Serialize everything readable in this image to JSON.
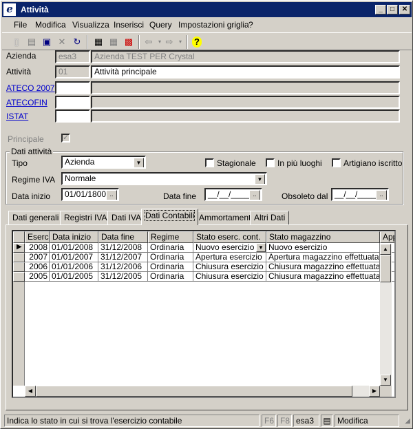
{
  "window": {
    "title": "Attività"
  },
  "menu": [
    "File",
    "Modifica",
    "Visualizza",
    "Inserisci",
    "Query",
    "Impostazioni griglia",
    "?"
  ],
  "form": {
    "azienda": {
      "label": "Azienda",
      "code": "esa3",
      "name": "Azienda TEST PER Crystal"
    },
    "attivita": {
      "label": "Attività",
      "code": "01",
      "name": "Attività principale"
    },
    "ateco": {
      "label": "ATECO 2007",
      "code": "",
      "name": ""
    },
    "atecofin": {
      "label": "ATECOFIN",
      "code": "",
      "name": ""
    },
    "istat": {
      "label": "ISTAT",
      "code": "",
      "name": ""
    },
    "principale": {
      "label": "Principale",
      "checked": true
    }
  },
  "dati_attivita": {
    "legend": "Dati attività",
    "tipo_label": "Tipo",
    "tipo_value": "Azienda",
    "stagionale": "Stagionale",
    "piu_luoghi": "In più luoghi",
    "artigiano": "Artigiano iscritto",
    "regime_label": "Regime IVA",
    "regime_value": "Normale",
    "data_inizio_label": "Data inizio",
    "data_inizio": "01/01/1800",
    "data_fine_label": "Data fine",
    "data_fine": "__/__/____",
    "obsoleto_label": "Obsoleto dal",
    "obsoleto": "__/__/____",
    "dots": ".."
  },
  "tabs": [
    "Dati generali",
    "Registri IVA",
    "Dati IVA",
    "Dati Contabili",
    "Ammortamenti",
    "Altri Dati"
  ],
  "grid": {
    "columns": [
      "Eserc.",
      "Data inizio",
      "Data fine",
      "Regime",
      "Stato eserc. cont.",
      "Stato magazzino",
      "App"
    ],
    "rows": [
      [
        "2008",
        "01/01/2008",
        "31/12/2008",
        "Ordinaria",
        "Nuovo esercizio",
        "Nuovo esercizio"
      ],
      [
        "2007",
        "01/01/2007",
        "31/12/2007",
        "Ordinaria",
        "Apertura esercizio",
        "Apertura magazzino effettuata"
      ],
      [
        "2006",
        "01/01/2006",
        "31/12/2006",
        "Ordinaria",
        "Chiusura esercizio",
        "Chiusura magazzino effettuata"
      ],
      [
        "2005",
        "01/01/2005",
        "31/12/2005",
        "Ordinaria",
        "Chiusura esercizio",
        "Chiusura magazzino effettuata"
      ]
    ]
  },
  "statusbar": {
    "message": "Indica lo stato in cui si trova l'esercizio contabile",
    "f6": "F6",
    "f8": "F8",
    "company": "esa3",
    "mode": "Modifica"
  },
  "colors": {
    "titlebar": "#0a246a",
    "face": "#d4d0c8",
    "link": "#0000cc"
  }
}
